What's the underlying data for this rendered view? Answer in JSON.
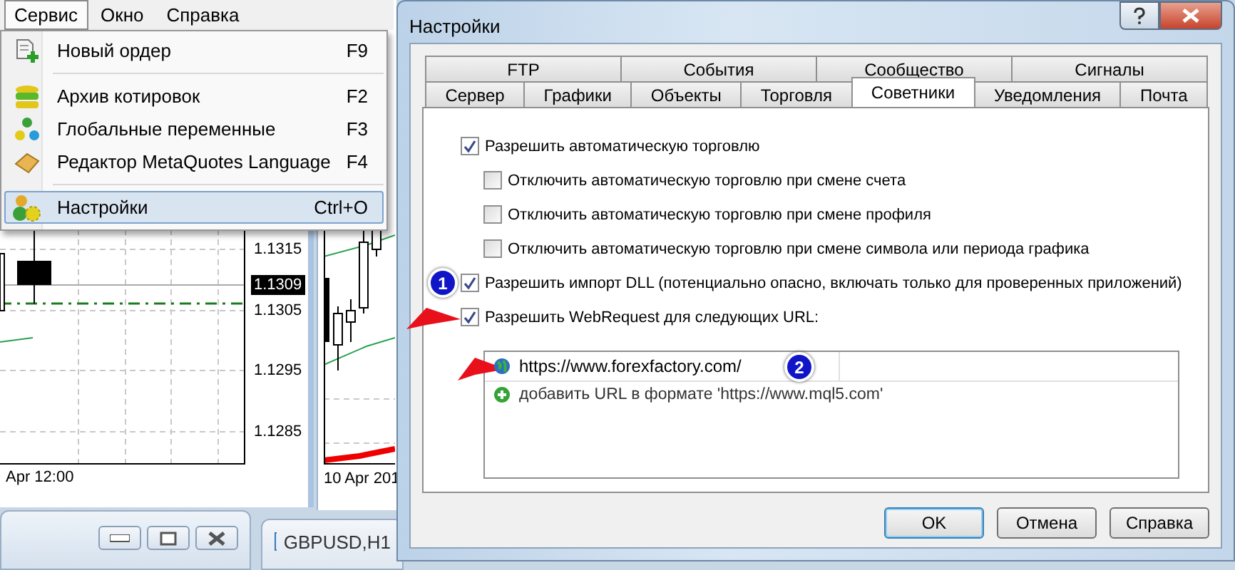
{
  "menu_bar": [
    {
      "label": "Сервис",
      "selected": true
    },
    {
      "label": "Окно",
      "selected": false
    },
    {
      "label": "Справка",
      "selected": false
    }
  ],
  "dropdown": [
    {
      "kind": "item",
      "label": "Новый ордер",
      "shortcut": "F9",
      "selected": false
    },
    {
      "kind": "separator"
    },
    {
      "kind": "item",
      "label": "Архив котировок",
      "shortcut": "F2",
      "selected": false
    },
    {
      "kind": "item",
      "label": "Глобальные переменные",
      "shortcut": "F3",
      "selected": false
    },
    {
      "kind": "item",
      "label": "Редактор MetaQuotes Language",
      "shortcut": "F4",
      "selected": false
    },
    {
      "kind": "separator"
    },
    {
      "kind": "item",
      "label": "Настройки",
      "shortcut": "Ctrl+O",
      "selected": true
    }
  ],
  "chart_left": {
    "price_labels": [
      "1.1315",
      "1.1305",
      "1.1295",
      "1.1285"
    ],
    "current_price": "1.1309",
    "time_label": "Apr 12:00"
  },
  "chart_right": {
    "time_label": "10 Apr 201"
  },
  "bottom_window": {
    "tab_title": "GBPUSD,H1"
  },
  "dialog": {
    "title": "Настройки",
    "tabs_row1": [
      {
        "label": "FTP",
        "selected": false
      },
      {
        "label": "События",
        "selected": false
      },
      {
        "label": "Сообщество",
        "selected": false
      },
      {
        "label": "Сигналы",
        "selected": false
      }
    ],
    "tabs_row2": [
      {
        "label": "Сервер",
        "selected": false
      },
      {
        "label": "Графики",
        "selected": false
      },
      {
        "label": "Объекты",
        "selected": false
      },
      {
        "label": "Торговля",
        "selected": false
      },
      {
        "label": "Советники",
        "selected": true
      },
      {
        "label": "Уведомления",
        "selected": false
      },
      {
        "label": "Почта",
        "selected": false
      }
    ],
    "options": [
      {
        "label": "Разрешить автоматическую торговлю",
        "checked": true,
        "children": [
          {
            "label": "Отключить автоматическую торговлю при смене счета",
            "checked": false
          },
          {
            "label": "Отключить автоматическую торговлю при смене профиля",
            "checked": false
          },
          {
            "label": "Отключить автоматическую торговлю при смене символа или периода графика",
            "checked": false
          }
        ]
      },
      {
        "label": "Разрешить импорт DLL (потенциально опасно, включать только для проверенных приложений)",
        "checked": true,
        "badge": "1"
      },
      {
        "label": "Разрешить WebRequest для следующих URL:",
        "checked": true,
        "arrow": true
      }
    ],
    "urls": [
      {
        "url": "https://www.forexfactory.com/",
        "badge": "2",
        "arrow": true
      }
    ],
    "add_hint": "добавить URL в формате 'https://www.mql5.com'",
    "buttons": [
      {
        "label": "OK",
        "default": true
      },
      {
        "label": "Отмена",
        "default": false
      },
      {
        "label": "Справка",
        "default": false
      }
    ]
  }
}
